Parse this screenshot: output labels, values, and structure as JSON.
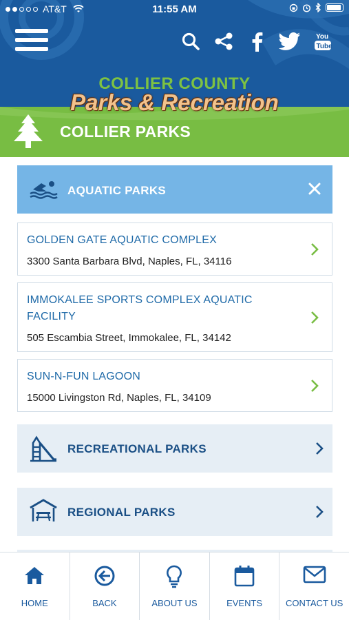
{
  "status_bar": {
    "carrier": "AT&T",
    "time": "11:55 AM",
    "battery_level": 0.9
  },
  "header": {
    "brand_top": "COLLIER COUNTY",
    "brand_main": "Parks & Recreation",
    "social_icons": [
      "search-icon",
      "share-icon",
      "facebook-icon",
      "twitter-icon",
      "youtube-icon"
    ]
  },
  "section": {
    "title": "COLLIER PARKS",
    "icon": "tree-icon"
  },
  "categories": {
    "aquatic": {
      "label": "AQUATIC PARKS",
      "icon": "swimmer-icon"
    },
    "recreational": {
      "label": "RECREATIONAL PARKS",
      "icon": "playground-slide-icon"
    },
    "regional": {
      "label": "REGIONAL PARKS",
      "icon": "picnic-shelter-icon"
    }
  },
  "parks": [
    {
      "name": "GOLDEN GATE AQUATIC COMPLEX",
      "address": "3300 Santa Barbara Blvd, Naples, FL, 34116"
    },
    {
      "name_line1": "IMMOKALEE SPORTS COMPLEX AQUATIC",
      "name_line2": "FACILITY",
      "address": "505 Escambia Street, Immokalee, FL, 34142"
    },
    {
      "name": "SUN-N-FUN LAGOON",
      "address": "15000 Livingston Rd, Naples, FL, 34109"
    }
  ],
  "bottom_nav": [
    {
      "label": "HOME",
      "icon": "home-icon"
    },
    {
      "label": "BACK",
      "icon": "back-arrow-icon"
    },
    {
      "label": "ABOUT US",
      "icon": "lightbulb-icon"
    },
    {
      "label": "EVENTS",
      "icon": "calendar-icon"
    },
    {
      "label": "CONTACT US",
      "icon": "envelope-icon"
    }
  ],
  "colors": {
    "header_blue": "#1a5a9e",
    "accent_green": "#78bd43",
    "open_category_blue": "#75b5e6",
    "link_blue": "#1f6aa8",
    "closed_category_bg": "#e6eef5"
  }
}
